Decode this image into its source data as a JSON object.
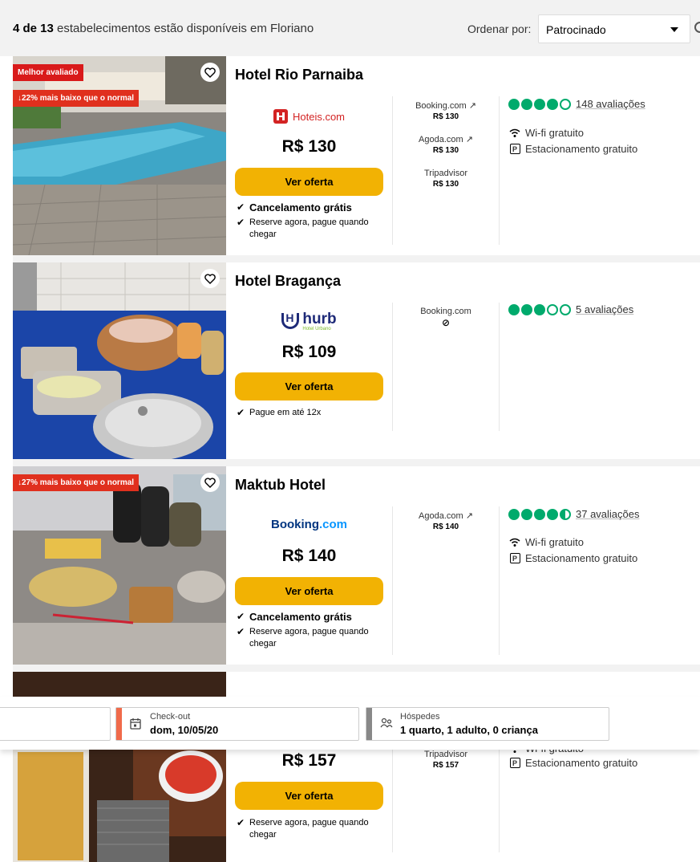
{
  "header": {
    "count_bold": "4 de 13",
    "count_rest": " estabelecimentos estão disponíveis em Floriano",
    "sort_label": "Ordenar por:",
    "sort_value": "Patrocinado"
  },
  "hotels": [
    {
      "name": "Hotel Rio Parnaiba",
      "badges": [
        "Melhor avaliado",
        "↓22% mais baixo que o normal"
      ],
      "provider": "Hoteis.com",
      "price": "R$ 130",
      "button": "Ver oferta",
      "perks": [
        "Cancelamento grátis",
        "Reserve agora, pague quando",
        "chegar"
      ],
      "others": [
        {
          "site": "Booking.com ↗",
          "price": "R$ 130"
        },
        {
          "site": "Agoda.com ↗",
          "price": "R$ 130"
        },
        {
          "site": "Tripadvisor",
          "price": "R$ 130"
        }
      ],
      "rating": 4,
      "reviews": "148 avaliações",
      "amenities": [
        "Wi-fi gratuito",
        "Estacionamento gratuito"
      ]
    },
    {
      "name": "Hotel Bragança",
      "provider_main": "hurb",
      "provider_sub": "Hotel Urbano",
      "price": "R$ 109",
      "button": "Ver oferta",
      "perks": [
        "Pague em até 12x"
      ],
      "others": [
        {
          "site": "Booking.com",
          "price": "⊘"
        }
      ],
      "rating": 3,
      "reviews": "5 avaliações"
    },
    {
      "name": "Maktub Hotel",
      "badges": [
        "↓27% mais baixo que o normal"
      ],
      "provider_main": "Booking",
      "provider_suffix": ".com",
      "price": "R$ 140",
      "button": "Ver oferta",
      "perks": [
        "Cancelamento grátis",
        "Reserve agora, pague quando",
        "chegar"
      ],
      "others": [
        {
          "site": "Agoda.com ↗",
          "price": "R$ 140"
        }
      ],
      "rating": 4.5,
      "reviews": "37 avaliações",
      "amenities": [
        "Wi-fi gratuito",
        "Estacionamento gratuito"
      ]
    },
    {
      "price": "R$ 157",
      "button": "Ver oferta",
      "perks": [
        "Reserve agora, pague quando",
        "chegar"
      ],
      "others": [
        {
          "site": "Tripadvisor",
          "price": "R$ 157"
        }
      ],
      "amenities_partial": "Wi-fi gratuito",
      "amenities": [
        "Estacionamento gratuito"
      ]
    }
  ],
  "datebar": {
    "checkout_label": "Check-out",
    "checkout_value": "dom, 10/05/20",
    "guests_label": "Hóspedes",
    "guests_value": "1 quarto, 1 adulto, 0 criança"
  },
  "colors": {
    "cta": "#f2b203",
    "badge": "#d91a1a",
    "rating": "#00aa6c",
    "hoteis": "#d32323",
    "booking": "#003580",
    "hurb": "#1e2a78"
  }
}
